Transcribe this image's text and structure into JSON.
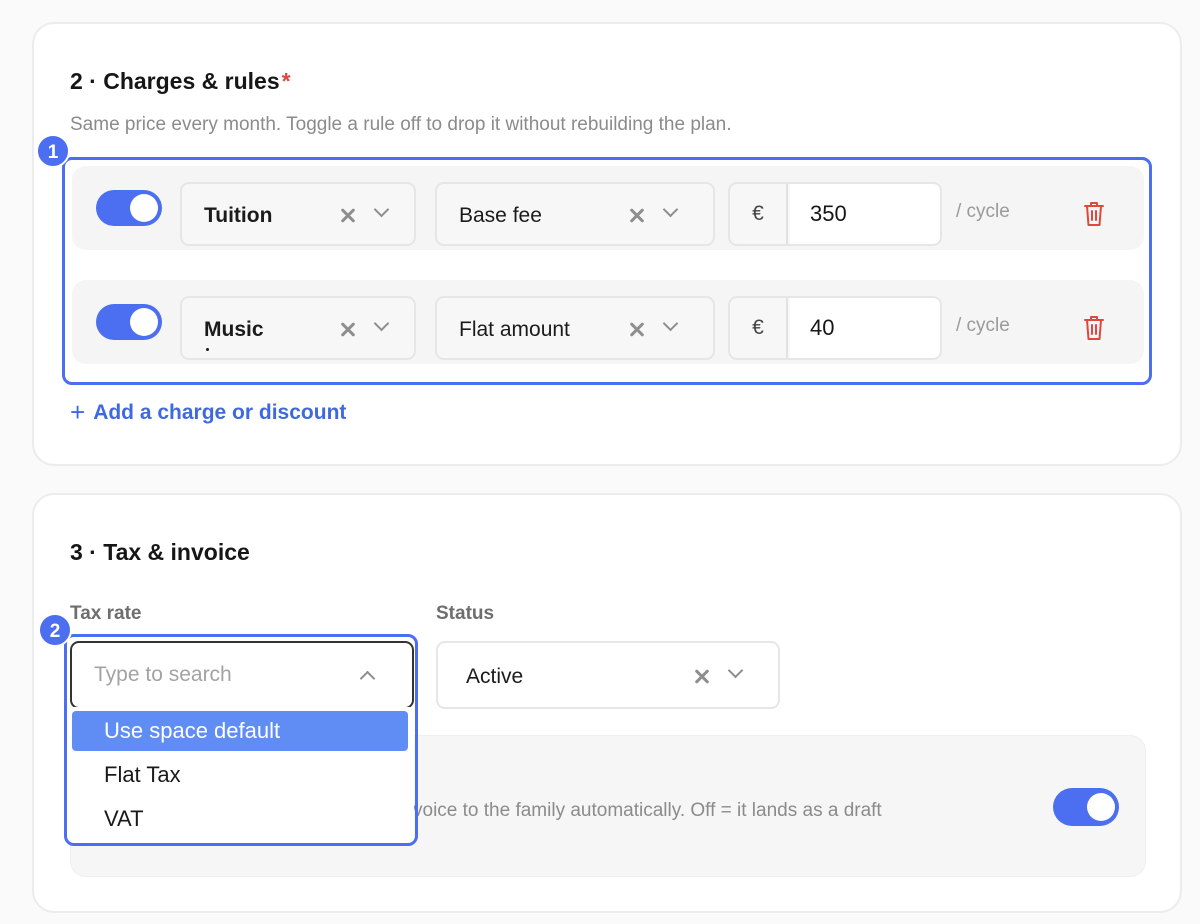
{
  "charges": {
    "title": "2 · Charges & rules",
    "required_mark": "*",
    "description": "Same price every month. Toggle a rule off to drop it without rebuilding the plan.",
    "rules": [
      {
        "enabled": true,
        "category": "Tuition",
        "type": "Base fee",
        "currency": "€",
        "amount": "350",
        "per": "/ cycle"
      },
      {
        "enabled": true,
        "category": "Music",
        "type": "Flat amount",
        "currency": "€",
        "amount": "40",
        "per": "/ cycle"
      }
    ],
    "add_label": "Add a charge or discount",
    "add_icon": "+"
  },
  "tax": {
    "title": "3 · Tax & invoice",
    "tax_rate_label": "Tax rate",
    "tax_rate_placeholder": "Type to search",
    "tax_rate_options": [
      "Use space default",
      "Flat Tax",
      "VAT"
    ],
    "tax_rate_highlighted": "Use space default",
    "status_label": "Status",
    "status_value": "Active",
    "auto_send_description_visible": "voice to the family automatically. Off = it lands as a draft",
    "auto_send_enabled": true
  },
  "annotations": {
    "badge_1": "1",
    "badge_2": "2"
  },
  "colors": {
    "accent": "#4c6ef0",
    "required": "#e0473f",
    "delete": "#e0473f",
    "option_highlight": "#5f8df3"
  }
}
